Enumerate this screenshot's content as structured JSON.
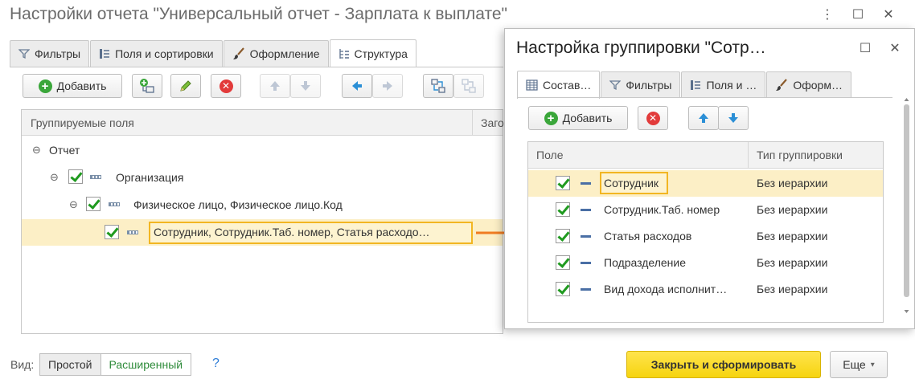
{
  "window": {
    "title": "Настройки отчета \"Универсальный отчет - Зарплата к выплате\"",
    "menu_glyph": "⋮",
    "maximize_glyph": "☐",
    "close_glyph": "✕"
  },
  "tabs": [
    {
      "label": "Фильтры",
      "icon": "funnel-icon"
    },
    {
      "label": "Поля и сортировки",
      "icon": "list-icon"
    },
    {
      "label": "Оформление",
      "icon": "brush-icon"
    },
    {
      "label": "Структура",
      "icon": "tree-icon",
      "active": true
    }
  ],
  "toolbar": {
    "add_label": "Добавить",
    "add_glyph": "+",
    "delete_glyph": "✕"
  },
  "grid": {
    "columns": [
      "Группируемые поля",
      "Заго"
    ],
    "collapse_glyph": "⊖",
    "rows": [
      {
        "label": "Отчет",
        "level": 0
      },
      {
        "label": "Организация",
        "level": 1
      },
      {
        "label": "Физическое лицо, Физическое лицо.Код",
        "level": 2
      },
      {
        "label": "Сотрудник, Сотрудник.Таб. номер, Статья расходо…",
        "level": 3,
        "selected": true
      }
    ]
  },
  "dialog": {
    "title": "Настройка группировки \"Сотр…",
    "maximize_glyph": "☐",
    "close_glyph": "✕",
    "tabs": [
      {
        "label": "Состав…",
        "icon": "table-icon",
        "active": true
      },
      {
        "label": "Фильтры",
        "icon": "funnel-icon"
      },
      {
        "label": "Поля и …",
        "icon": "list-icon"
      },
      {
        "label": "Оформ…",
        "icon": "brush-icon"
      }
    ],
    "add_label": "Добавить",
    "columns": [
      "Поле",
      "Тип группировки"
    ],
    "rows": [
      {
        "field": "Сотрудник",
        "type": "Без иерархии",
        "selected": true
      },
      {
        "field": "Сотрудник.Таб. номер",
        "type": "Без иерархии"
      },
      {
        "field": "Статья расходов",
        "type": "Без иерархии"
      },
      {
        "field": "Подразделение",
        "type": "Без иерархии"
      },
      {
        "field": "Вид дохода исполнит…",
        "type": "Без иерархии"
      }
    ]
  },
  "bottom": {
    "view_label": "Вид:",
    "simple": "Простой",
    "extended": "Расширенный",
    "help": "?",
    "primary_button": "Закрыть и сформировать",
    "more_button": "Еще",
    "more_glyph": "▾"
  },
  "colors": {
    "accent_yellow": "#f6d40f",
    "selection": "#fcefc6",
    "highlight_border": "#f2b622",
    "arrow": "#f07c22",
    "check": "#1f9a1f"
  }
}
